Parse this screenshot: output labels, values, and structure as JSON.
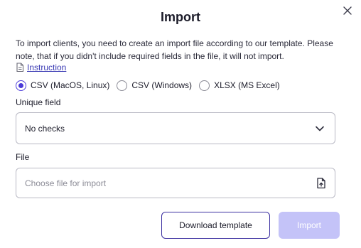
{
  "modal": {
    "title": "Import",
    "description": "To import clients, you need to create an import file according to our template. Please note, that if you didn't include required fields in the file, it will not import.",
    "instruction_link": "Instruction"
  },
  "format": {
    "options": [
      {
        "label": "CSV (MacOS, Linux)",
        "checked": true
      },
      {
        "label": "CSV (Windows)",
        "checked": false
      },
      {
        "label": "XLSX (MS Excel)",
        "checked": false
      }
    ]
  },
  "unique_field": {
    "label": "Unique field",
    "selected": "No checks"
  },
  "file": {
    "label": "File",
    "placeholder": "Choose file for import"
  },
  "actions": {
    "download_label": "Download template",
    "import_label": "Import"
  },
  "colors": {
    "accent": "#4a3ad8",
    "primary_disabled": "#c4c3f8",
    "outline_border": "#3b2fa0"
  }
}
